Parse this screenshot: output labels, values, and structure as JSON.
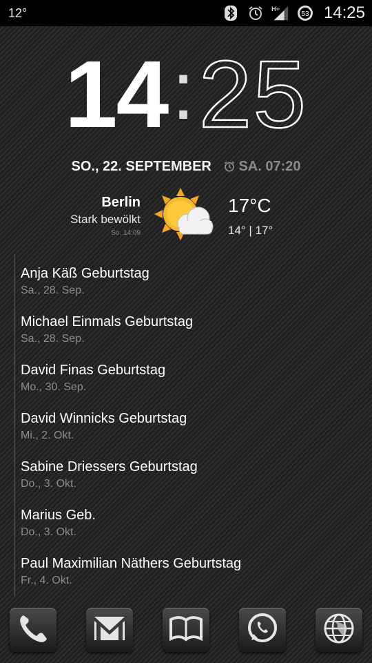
{
  "statusbar": {
    "left_text": "12°",
    "time": "14:25",
    "battery_level": "53",
    "icons": [
      "bluetooth-icon",
      "alarm-icon",
      "signal-hplus-icon",
      "battery-icon"
    ]
  },
  "clock": {
    "hours": "14",
    "separator": ":",
    "minutes": "25"
  },
  "date": {
    "text": "SO., 22. SEPTEMBER",
    "alarm": "SA. 07:20"
  },
  "weather": {
    "city": "Berlin",
    "condition": "Stark bewölkt",
    "updated": "So. 14:09",
    "temperature": "17°C",
    "range": "14° | 17°",
    "icon": "sun-cloud-icon"
  },
  "agenda": [
    {
      "title": "Anja Käß Geburtstag",
      "date": "Sa., 28. Sep."
    },
    {
      "title": "Michael Einmals Geburtstag",
      "date": "Sa., 28. Sep."
    },
    {
      "title": "David Finas Geburtstag",
      "date": "Mo., 30. Sep."
    },
    {
      "title": "David Winnicks Geburtstag",
      "date": "Mi., 2. Okt."
    },
    {
      "title": "Sabine Driessers Geburtstag",
      "date": "Do., 3. Okt."
    },
    {
      "title": "Marius Geb.",
      "date": "Do., 3. Okt."
    },
    {
      "title": "Paul Maximilian Näthers Geburtstag",
      "date": "Fr., 4. Okt."
    }
  ],
  "dock": [
    "phone-icon",
    "gmail-icon",
    "book-icon",
    "whatsapp-icon",
    "globe-icon"
  ]
}
